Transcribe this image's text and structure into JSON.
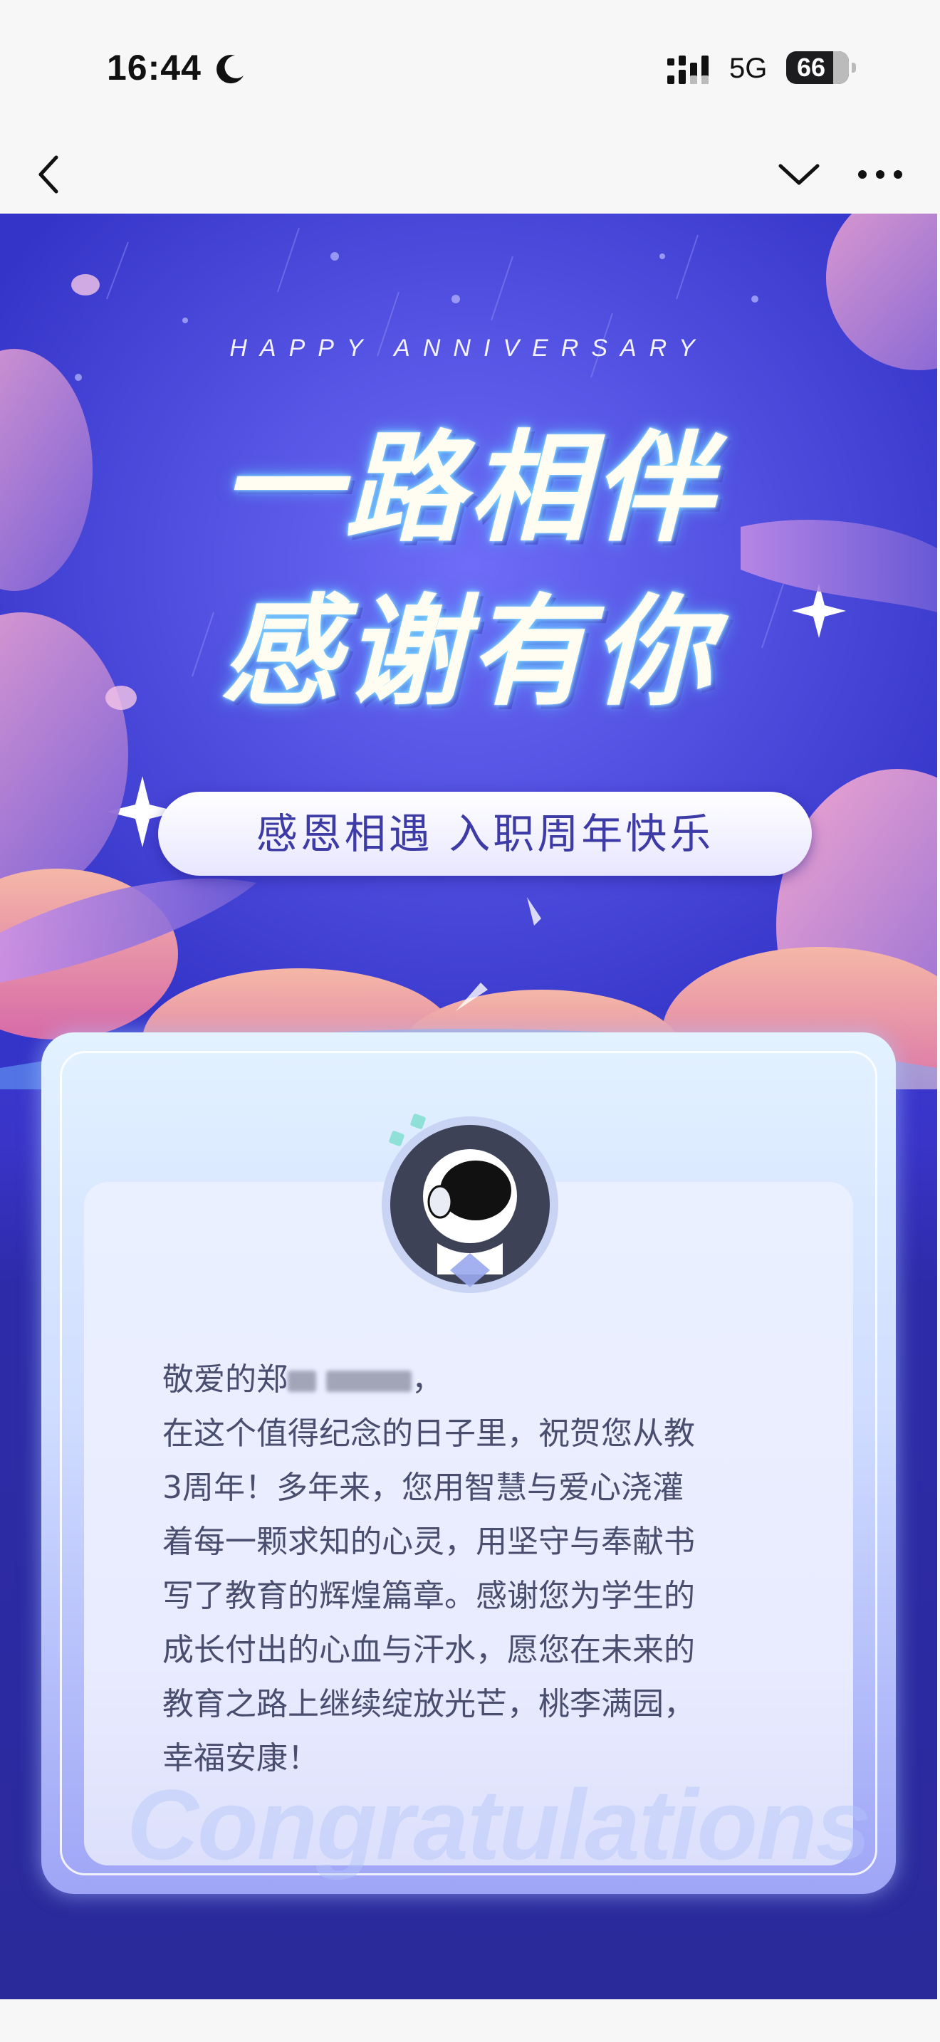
{
  "status_bar": {
    "time": "16:44",
    "network": "5G",
    "battery": "66"
  },
  "icons": {
    "moon": "moon-icon",
    "signal": "signal-icon",
    "back": "chevron-left-icon",
    "collapse": "chevron-down-icon",
    "more": "more-icon"
  },
  "poster": {
    "tagline": "HAPPY ANNIVERSARY",
    "headline_1": "一路相伴",
    "headline_2": "感谢有你",
    "subtitle": "感恩相遇 入职周年快乐",
    "watermark": "Congratulations"
  },
  "letter": {
    "salutation": "敬爱的郑",
    "salutation_end": "，",
    "lines": [
      "在这个值得纪念的日子里，祝贺您从教",
      "3周年！多年来，您用智慧与爱心浇灌",
      "着每一颗求知的心灵，用坚守与奉献书",
      "写了教育的辉煌篇章。感谢您为学生的",
      "成长付出的心血与汗水，愿您在未来的",
      "教育之路上继续绽放光芒，桃李满园，",
      "幸福安康！"
    ]
  },
  "colors": {
    "poster_bg": "#3a3ad0",
    "card_bg": "#cfdcff",
    "text": "#4a4e6e",
    "pill_text": "#3d3ba6"
  }
}
